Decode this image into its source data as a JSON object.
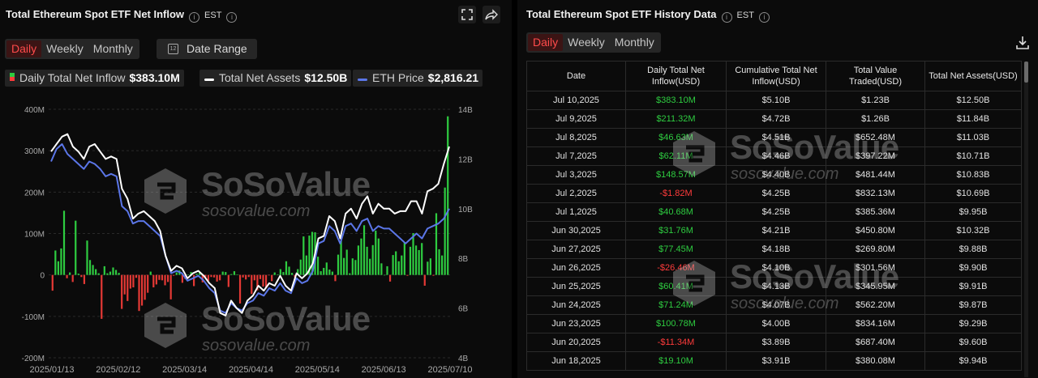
{
  "left_panel": {
    "title": "Total Ethereum Spot ETF Net Inflow",
    "timezone": "EST",
    "tabs": [
      "Daily",
      "Weekly",
      "Monthly"
    ],
    "active_tab": "Daily",
    "date_range_label": "Date Range",
    "legend": [
      {
        "label": "Daily Total Net Inflow",
        "value": "$383.10M",
        "color": "#2ecc40"
      },
      {
        "label": "Total Net Assets",
        "value": "$12.50B",
        "color": "#ffffff"
      },
      {
        "label": "ETH Price",
        "value": "$2,816.21",
        "color": "#5b76e8"
      }
    ]
  },
  "right_panel": {
    "title": "Total Ethereum Spot ETF History Data",
    "timezone": "EST",
    "tabs": [
      "Daily",
      "Weekly",
      "Monthly"
    ],
    "active_tab": "Daily",
    "table": {
      "columns": [
        "Date",
        "Daily Total Net Inflow(USD)",
        "Cumulative Total Net Inflow(USD)",
        "Total Value Traded(USD)",
        "Total Net Assets(USD)"
      ],
      "rows": [
        [
          "Jul 10,2025",
          "$383.10M",
          "$5.10B",
          "$1.23B",
          "$12.50B"
        ],
        [
          "Jul 9,2025",
          "$211.32M",
          "$4.72B",
          "$1.26B",
          "$11.84B"
        ],
        [
          "Jul 8,2025",
          "$46.63M",
          "$4.51B",
          "$652.48M",
          "$11.03B"
        ],
        [
          "Jul 7,2025",
          "$62.11M",
          "$4.46B",
          "$397.22M",
          "$10.71B"
        ],
        [
          "Jul 3,2025",
          "$148.57M",
          "$4.40B",
          "$481.44M",
          "$10.83B"
        ],
        [
          "Jul 2,2025",
          "-$1.82M",
          "$4.25B",
          "$832.13M",
          "$10.69B"
        ],
        [
          "Jul 1,2025",
          "$40.68M",
          "$4.25B",
          "$385.36M",
          "$9.95B"
        ],
        [
          "Jun 30,2025",
          "$31.76M",
          "$4.21B",
          "$450.80M",
          "$10.32B"
        ],
        [
          "Jun 27,2025",
          "$77.45M",
          "$4.18B",
          "$269.80M",
          "$9.88B"
        ],
        [
          "Jun 26,2025",
          "-$26.46M",
          "$4.10B",
          "$301.56M",
          "$9.90B"
        ],
        [
          "Jun 25,2025",
          "$60.41M",
          "$4.13B",
          "$345.95M",
          "$9.91B"
        ],
        [
          "Jun 24,2025",
          "$71.24M",
          "$4.07B",
          "$562.20M",
          "$9.87B"
        ],
        [
          "Jun 23,2025",
          "$100.78M",
          "$4.00B",
          "$834.16M",
          "$9.29B"
        ],
        [
          "Jun 20,2025",
          "-$11.34M",
          "$3.89B",
          "$687.40M",
          "$9.60B"
        ],
        [
          "Jun 18,2025",
          "$19.10M",
          "$3.91B",
          "$380.08M",
          "$9.94B"
        ]
      ]
    }
  },
  "watermark": {
    "brand": "SoSoValue",
    "url": "sosovalue.com"
  },
  "chart_data": {
    "type": "bar",
    "x_tick_labels": [
      "2025/01/13",
      "2025/02/12",
      "2025/03/14",
      "2025/04/14",
      "2025/05/14",
      "2025/06/13",
      "2025/07/10"
    ],
    "y_left": {
      "ticks": [
        "400M",
        "300M",
        "200M",
        "100M",
        "0",
        "-100M",
        "-200M"
      ],
      "range": [
        -200,
        400
      ],
      "unit": "M USD"
    },
    "y_right": {
      "ticks": [
        "14B",
        "12B",
        "10B",
        "8B",
        "6B",
        "4B"
      ],
      "range": [
        4,
        14
      ],
      "unit": "B USD"
    },
    "grid": "horizontal dashed",
    "series": [
      {
        "name": "Daily Total Net Inflow",
        "kind": "bar",
        "axis": "left",
        "values": [
          -38,
          59,
          33,
          64,
          155,
          -8,
          6,
          -17,
          131,
          3,
          -5,
          -22,
          83,
          36,
          24,
          14,
          4,
          -106,
          21,
          4,
          8,
          18,
          12,
          5,
          -82,
          -47,
          -63,
          -33,
          -30,
          -7,
          -87,
          -74,
          -60,
          -43,
          8,
          -30,
          -23,
          -12,
          -13,
          -25,
          -17,
          -59,
          -2,
          6,
          11,
          -19,
          -10,
          1,
          7,
          -27,
          3,
          7,
          -18,
          -6,
          -14,
          -5,
          -6,
          -16,
          -13,
          8,
          7,
          -29,
          2,
          9,
          1,
          -69,
          -6,
          -11,
          -5,
          -46,
          -13,
          -37,
          -10,
          -28,
          -32,
          -1,
          -15,
          6,
          1,
          14,
          7,
          33,
          20,
          5,
          -6,
          14,
          37,
          93,
          47,
          95,
          104,
          103,
          44,
          9,
          17,
          30,
          13,
          8,
          -15,
          49,
          83,
          41,
          61,
          4,
          40,
          36,
          71,
          88,
          120,
          68,
          39,
          72,
          107,
          88,
          28,
          0,
          21,
          -16,
          48,
          57,
          33,
          47,
          79,
          -2,
          68,
          101,
          71,
          60,
          77,
          -26,
          32,
          40,
          -2,
          149,
          62,
          47,
          211,
          383
        ]
      },
      {
        "name": "Total Net Assets",
        "kind": "line",
        "axis": "right",
        "values": [
          12.3,
          12.6,
          12.9,
          13.0,
          12.5,
          12.3,
          12.0,
          12.5,
          12.6,
          12.3,
          12.0,
          12.1,
          12.0,
          10.8,
          10.4,
          9.6,
          9.8,
          9.9,
          9.7,
          9.5,
          9.1,
          8.1,
          7.5,
          7.7,
          7.6,
          7.2,
          7.4,
          7.5,
          7.3,
          7.0,
          6.8,
          5.8,
          5.7,
          6.3,
          6.0,
          5.8,
          6.3,
          6.5,
          6.9,
          6.7,
          7.0,
          6.9,
          7.3,
          6.9,
          6.7,
          7.4,
          7.2,
          7.4,
          7.8,
          8.8,
          8.9,
          9.7,
          9.5,
          8.8,
          9.8,
          10.0,
          9.6,
          10.2,
          10.5,
          9.8,
          10.2,
          10.0,
          10.0,
          9.8,
          9.9,
          9.9,
          10.3,
          10.3,
          9.8,
          10.7,
          10.8,
          11.0,
          11.8,
          12.5
        ],
        "points_note": "approximate shape"
      },
      {
        "name": "ETH Price",
        "kind": "line",
        "axis": "right",
        "values": [
          11.9,
          12.4,
          12.6,
          12.2,
          12.0,
          11.8,
          11.6,
          11.9,
          11.8,
          11.6,
          11.3,
          11.4,
          11.3,
          10.1,
          9.9,
          9.4,
          9.5,
          9.5,
          9.3,
          9.1,
          8.9,
          8.1,
          7.4,
          7.5,
          7.4,
          7.1,
          7.2,
          7.3,
          7.1,
          6.8,
          6.6,
          5.9,
          5.8,
          6.2,
          6.0,
          5.9,
          6.2,
          6.3,
          6.6,
          6.5,
          6.8,
          6.7,
          7.0,
          6.7,
          6.6,
          7.2,
          7.0,
          7.1,
          7.5,
          8.6,
          8.7,
          9.3,
          9.1,
          8.6,
          9.3,
          9.4,
          9.1,
          9.5,
          9.6,
          9.1,
          9.3,
          9.2,
          9.2,
          9.0,
          8.8,
          8.6,
          8.8,
          9.0,
          8.8,
          9.2,
          9.3,
          9.4,
          9.6,
          10.0
        ]
      }
    ]
  }
}
